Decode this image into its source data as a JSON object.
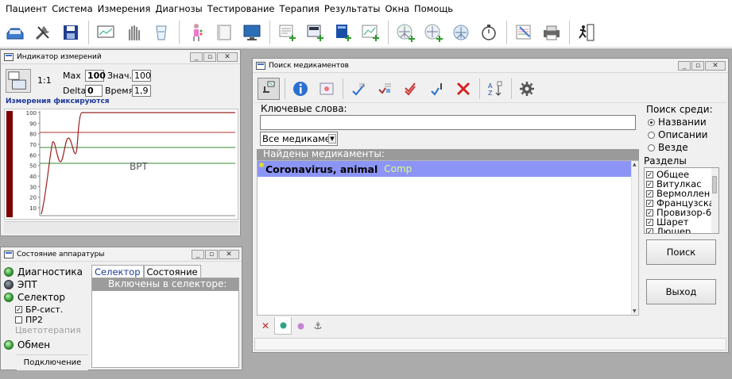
{
  "menubar": {
    "items": [
      "Пациент",
      "Система",
      "Измерения",
      "Диагнозы",
      "Тестирование",
      "Терапия",
      "Результаты",
      "Окна",
      "Помощь"
    ]
  },
  "toolbar": {
    "icons": [
      "open-tray-icon",
      "tools-icon",
      "save-icon",
      "monitor-icon",
      "hand-icon",
      "glass-icon",
      "body-icon",
      "book-icon",
      "computer-icon",
      "document-add-icon",
      "document-add-2-icon",
      "book-add-icon",
      "chart-add-icon",
      "vitruvian-add-icon",
      "vitruvian-add-2-icon",
      "vitruvian-icon",
      "stopwatch-icon",
      "document-edit-icon",
      "printer-icon",
      "exit-icon"
    ]
  },
  "indicator": {
    "title": "Индикатор измерений",
    "ratio": "1:1",
    "max_label": "Max",
    "max_value": "100",
    "value_label": "Знач.",
    "value_value": "100",
    "delta_label": "Delta",
    "delta_value": "0",
    "time_label": "Время",
    "time_value": "1,9",
    "status": "Измерения фиксируются",
    "graph_label": "ВРТ",
    "yticks": [
      "100",
      "90",
      "80",
      "70",
      "60",
      "50",
      "40",
      "30",
      "20",
      "10"
    ]
  },
  "apparatus": {
    "title": "Состояние аппаратуры",
    "diagnostics": "Диагностика",
    "ept": "ЭПТ",
    "selector": "Селектор",
    "br_sist": "БР-сист.",
    "pr2": "ПР2",
    "color_therapy": "Цветотерапия",
    "exchange": "Обмен",
    "connection": "Подключение",
    "tab_selector": "Селектор",
    "tab_state": "Состояние",
    "panel_header": "Включены в селекторе:"
  },
  "search": {
    "title": "Поиск медикаментов",
    "keywords_label": "Ключевые слова:",
    "keywords_value": "",
    "dropdown_value": "Все медикамен",
    "found_header": "Найдены медикаменты:",
    "results": [
      {
        "name": "Coronavirus, animal",
        "tag": "Comp"
      }
    ],
    "search_among_label": "Поиск среди:",
    "radio": [
      {
        "label": "Названии",
        "selected": true
      },
      {
        "label": "Описании",
        "selected": false
      },
      {
        "label": "Везде",
        "selected": false
      }
    ],
    "sections_label": "Разделы описаний",
    "sections": [
      {
        "label": "Общее",
        "checked": true
      },
      {
        "label": "Витулкас",
        "checked": true
      },
      {
        "label": "Вермоллен",
        "checked": true
      },
      {
        "label": "Французская",
        "checked": true
      },
      {
        "label": "Провизор-6",
        "checked": true
      },
      {
        "label": "Шарет",
        "checked": true
      },
      {
        "label": "Люшер",
        "checked": true
      }
    ],
    "search_button": "Поиск",
    "exit_button": "Выход",
    "colors": {
      "result_bg": "#8c95f5",
      "tag_color": "#d9ff7a"
    }
  }
}
